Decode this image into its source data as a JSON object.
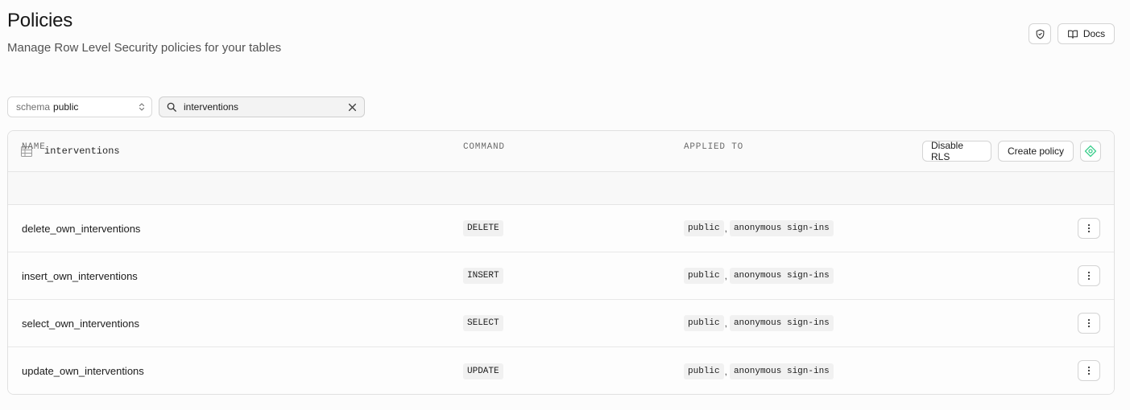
{
  "page": {
    "title": "Policies",
    "subtitle": "Manage Row Level Security policies for your tables"
  },
  "top_actions": {
    "rls_icon": "shield-check-icon",
    "docs_label": "Docs",
    "docs_icon": "book-open-icon"
  },
  "filters": {
    "schema_prefix": "schema",
    "schema_value": "public",
    "search_value": "interventions",
    "search_icon": "search-icon",
    "clear_icon": "close-icon"
  },
  "table": {
    "name": "interventions",
    "icon": "table-grid-icon",
    "disable_rls_label": "Disable RLS",
    "create_policy_label": "Create policy",
    "columns": {
      "name": "NAME",
      "command": "COMMAND",
      "applied_to": "APPLIED TO"
    },
    "rows": [
      {
        "name": "delete_own_interventions",
        "command": "DELETE",
        "roles": [
          "public",
          "anonymous sign-ins"
        ]
      },
      {
        "name": "insert_own_interventions",
        "command": "INSERT",
        "roles": [
          "public",
          "anonymous sign-ins"
        ]
      },
      {
        "name": "select_own_interventions",
        "command": "SELECT",
        "roles": [
          "public",
          "anonymous sign-ins"
        ]
      },
      {
        "name": "update_own_interventions",
        "command": "UPDATE",
        "roles": [
          "public",
          "anonymous sign-ins"
        ]
      }
    ],
    "role_separator": ","
  },
  "colors": {
    "accent_green": "#3ecf8e"
  }
}
